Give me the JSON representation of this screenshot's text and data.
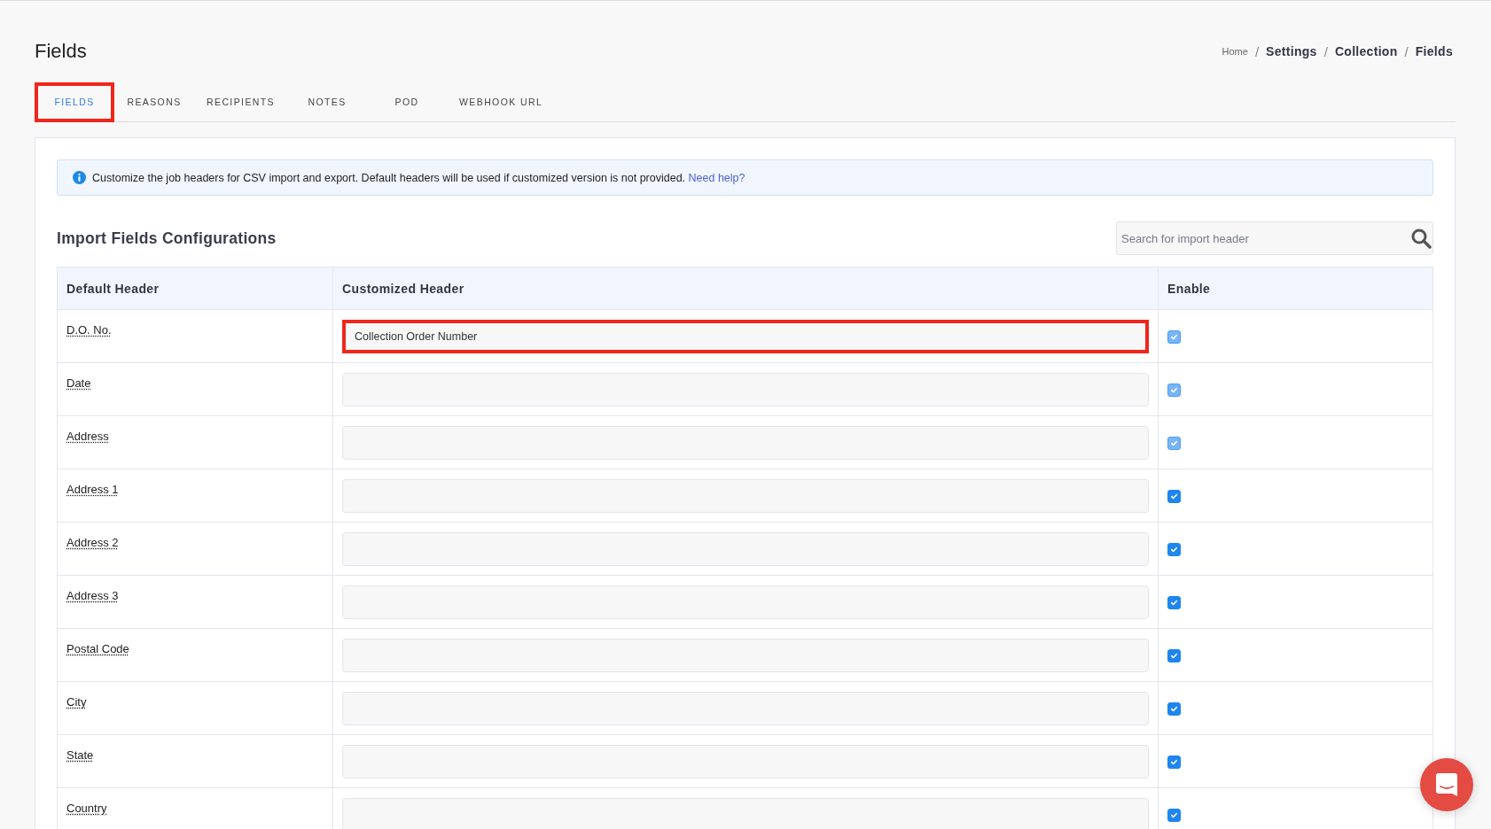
{
  "page_title": "Fields",
  "breadcrumb": [
    {
      "label": "Home",
      "kind": "link"
    },
    {
      "label": "Settings",
      "kind": "strong"
    },
    {
      "label": "Collection",
      "kind": "strong"
    },
    {
      "label": "Fields",
      "kind": "strong"
    }
  ],
  "breadcrumb_separator": "/",
  "tabs": [
    {
      "label": "FIELDS",
      "selected": true,
      "highlighted": true
    },
    {
      "label": "REASONS",
      "selected": false,
      "highlighted": false
    },
    {
      "label": "RECIPIENTS",
      "selected": false,
      "highlighted": false
    },
    {
      "label": "NOTES",
      "selected": false,
      "highlighted": false
    },
    {
      "label": "POD",
      "selected": false,
      "highlighted": false
    },
    {
      "label": "WEBHOOK URL",
      "selected": false,
      "highlighted": false
    }
  ],
  "info": {
    "text": "Customize the job headers for CSV import and export. Default headers will be used if customized version is not provided.",
    "link": "Need help?"
  },
  "section_title": "Import Fields Configurations",
  "search": {
    "placeholder": "Search for import header"
  },
  "table": {
    "columns": [
      "Default Header",
      "Customized Header",
      "Enable"
    ],
    "rows": [
      {
        "default_header": "D.O. No.",
        "customized_header": "Collection Order Number",
        "enabled": true,
        "disabled": true,
        "highlighted": true
      },
      {
        "default_header": "Date",
        "customized_header": "",
        "enabled": true,
        "disabled": true,
        "highlighted": false
      },
      {
        "default_header": "Address",
        "customized_header": "",
        "enabled": true,
        "disabled": true,
        "highlighted": false
      },
      {
        "default_header": "Address 1",
        "customized_header": "",
        "enabled": true,
        "disabled": false,
        "highlighted": false
      },
      {
        "default_header": "Address 2",
        "customized_header": "",
        "enabled": true,
        "disabled": false,
        "highlighted": false
      },
      {
        "default_header": "Address 3",
        "customized_header": "",
        "enabled": true,
        "disabled": false,
        "highlighted": false
      },
      {
        "default_header": "Postal Code",
        "customized_header": "",
        "enabled": true,
        "disabled": false,
        "highlighted": false
      },
      {
        "default_header": "City",
        "customized_header": "",
        "enabled": true,
        "disabled": false,
        "highlighted": false
      },
      {
        "default_header": "State",
        "customized_header": "",
        "enabled": true,
        "disabled": false,
        "highlighted": false
      },
      {
        "default_header": "Country",
        "customized_header": "",
        "enabled": true,
        "disabled": false,
        "highlighted": false
      }
    ]
  }
}
